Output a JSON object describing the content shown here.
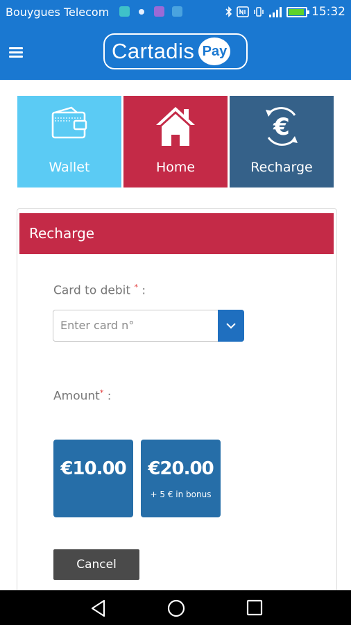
{
  "status_bar": {
    "carrier": "Bouygues Telecom",
    "time": "15:32",
    "icons": [
      "notification-icon",
      "dot-icon",
      "notification-icon",
      "notification-icon",
      "bluetooth-icon",
      "nfc-icon",
      "vibrate-icon",
      "signal-icon",
      "battery-icon"
    ],
    "colors": {
      "bar": "#1a78d1",
      "battery": "#5dd22a"
    }
  },
  "header": {
    "brand": "Cartadis",
    "brand_badge": "Pay",
    "menu_icon": "menu-icon",
    "color": "#1a78d1"
  },
  "tiles": [
    {
      "label": "Wallet",
      "icon": "wallet-icon",
      "color": "#5bcbf4"
    },
    {
      "label": "Home",
      "icon": "home-icon",
      "color": "#c42a47"
    },
    {
      "label": "Recharge",
      "icon": "euro-recharge-icon",
      "color": "#356189"
    }
  ],
  "recharge": {
    "title": "Recharge",
    "card_label": "Card to debit",
    "card_suffix": " :",
    "required_mark": "*",
    "card_placeholder": "Enter card n°",
    "amount_label": "Amount",
    "amount_suffix": " :",
    "amounts": [
      {
        "value": "€10.00",
        "bonus": ""
      },
      {
        "value": "€20.00",
        "bonus": "+ 5 € in bonus"
      }
    ],
    "cancel_label": "Cancel",
    "colors": {
      "header": "#c42a47",
      "amount": "#266ea8",
      "cancel": "#4a4a4a",
      "select_button": "#1f6fbf"
    }
  },
  "nav_bar": {
    "buttons": [
      "back-icon",
      "home-circle-icon",
      "recents-icon"
    ]
  }
}
